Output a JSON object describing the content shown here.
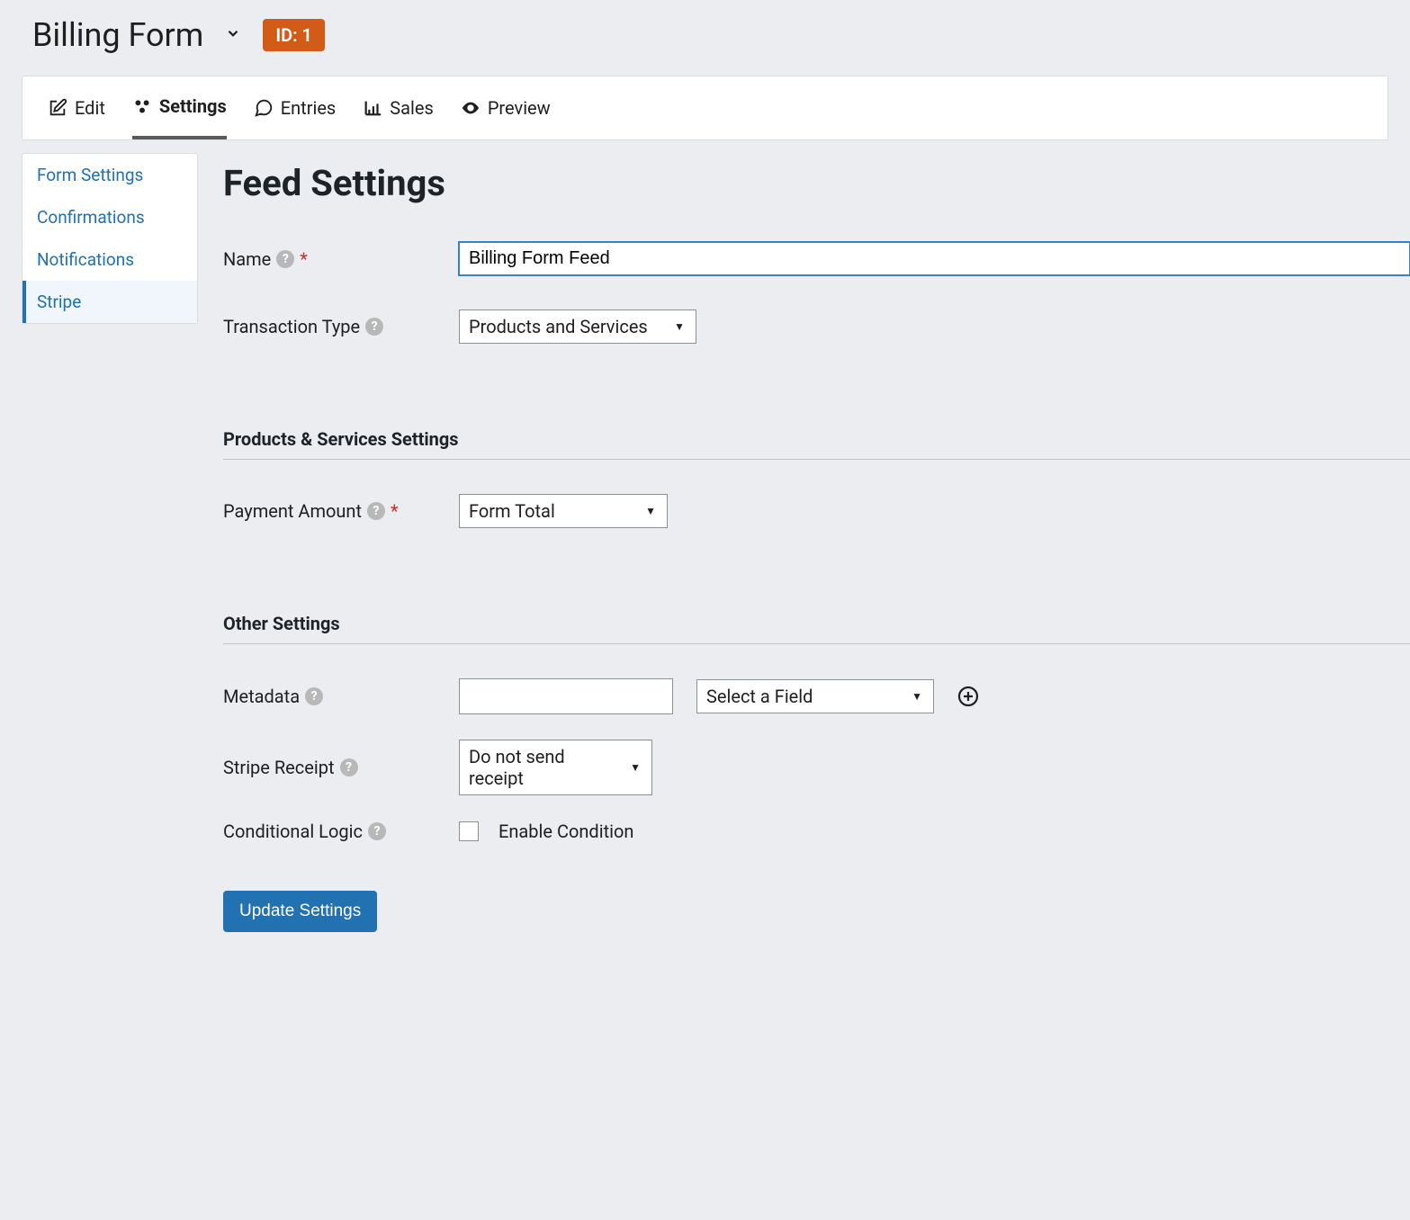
{
  "header": {
    "title": "Billing Form",
    "id_badge": "ID: 1"
  },
  "tabs": {
    "edit": "Edit",
    "settings": "Settings",
    "entries": "Entries",
    "sales": "Sales",
    "preview": "Preview"
  },
  "sidebar": {
    "form_settings": "Form Settings",
    "confirmations": "Confirmations",
    "notifications": "Notifications",
    "stripe": "Stripe"
  },
  "page": {
    "heading": "Feed Settings",
    "sections": {
      "products_services": "Products & Services Settings",
      "other": "Other Settings"
    },
    "labels": {
      "name": "Name",
      "transaction_type": "Transaction Type",
      "payment_amount": "Payment Amount",
      "metadata": "Metadata",
      "stripe_receipt": "Stripe Receipt",
      "conditional_logic": "Conditional Logic",
      "enable_condition": "Enable Condition"
    },
    "values": {
      "name": "Billing Form Feed",
      "transaction_type": "Products and Services",
      "payment_amount": "Form Total",
      "metadata_key": "",
      "metadata_field": "Select a Field",
      "stripe_receipt": "Do not send receipt"
    },
    "buttons": {
      "update": "Update Settings"
    }
  }
}
